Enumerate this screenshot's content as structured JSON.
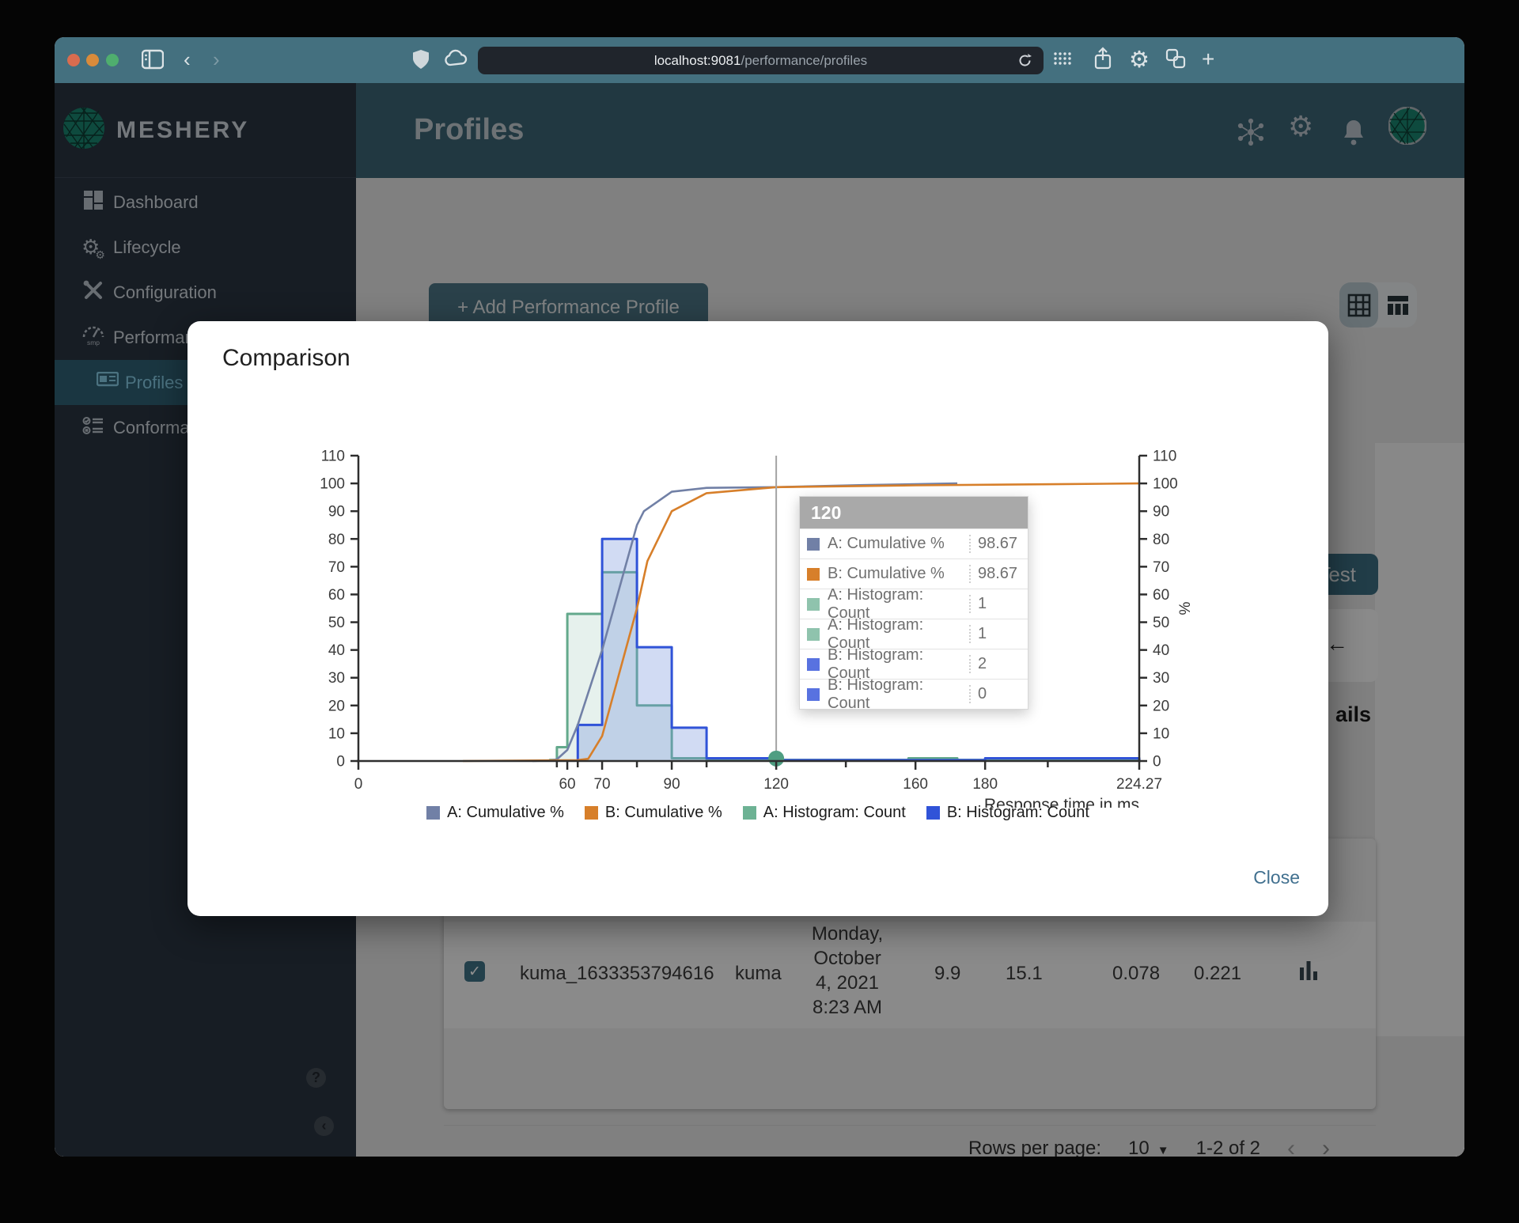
{
  "browser": {
    "url_host": "localhost:9081",
    "url_path": "/performance/profiles"
  },
  "sidebar": {
    "brand": "MESHERY",
    "items": [
      {
        "label": "Dashboard",
        "icon": "dashboard-icon",
        "selected": false
      },
      {
        "label": "Lifecycle",
        "icon": "gears-icon",
        "selected": false
      },
      {
        "label": "Configuration",
        "icon": "wrench-icon",
        "selected": false
      },
      {
        "label": "Performance",
        "icon": "speedometer-smp-icon",
        "selected": false
      },
      {
        "label": "Profiles",
        "icon": "monitor-icon",
        "selected": true
      },
      {
        "label": "Conformance",
        "icon": "checklist-icon",
        "selected": false
      }
    ],
    "help_label": "?",
    "collapse_label": "‹"
  },
  "header": {
    "title": "Profiles"
  },
  "background": {
    "add_button_label": "+ Add Performance Profile",
    "test_button_label": "Test",
    "back_arrow": "←",
    "details_fragment": "ails",
    "table_row": {
      "name": "kuma_1633353794616",
      "mesh": "kuma",
      "date_lines": [
        "Monday,",
        "October",
        "4, 2021",
        "8:23 AM"
      ],
      "qps": "9.9",
      "duration": "15.1",
      "p50": "0.078",
      "p99": "0.221"
    },
    "pagination": {
      "rows_per_page_label": "Rows per page:",
      "rows_per_page_value": "10",
      "range": "1-2 of 2",
      "prev": "‹",
      "next": "›"
    }
  },
  "modal": {
    "title": "Comparison",
    "close_label": "Close",
    "tooltip": {
      "header": "120",
      "rows": [
        {
          "label": "A: Cumulative %",
          "value": "98.67",
          "color": "#7180a6"
        },
        {
          "label": "B: Cumulative %",
          "value": "98.67",
          "color": "#d77f2a"
        },
        {
          "label": "A: Histogram: Count",
          "value": "1",
          "color": "#8fc3ad"
        },
        {
          "label": "A: Histogram: Count",
          "value": "1",
          "color": "#8fc3ad"
        },
        {
          "label": "B: Histogram: Count",
          "value": "2",
          "color": "#5872e0"
        },
        {
          "label": "B: Histogram: Count",
          "value": "0",
          "color": "#5872e0"
        }
      ]
    },
    "legend": [
      {
        "label": "A: Cumulative %",
        "color": "#7180a6"
      },
      {
        "label": "B: Cumulative %",
        "color": "#d77f2a"
      },
      {
        "label": "A: Histogram: Count",
        "color": "#6db294"
      },
      {
        "label": "B: Histogram: Count",
        "color": "#3053d8"
      }
    ]
  },
  "chart_data": {
    "type": "histogram+cumulative-line",
    "xlabel": "Response time in ms",
    "ylabel_right": "%",
    "xlim": [
      0,
      224.27
    ],
    "ylim": [
      0,
      110
    ],
    "y_ticks": [
      0,
      10,
      20,
      30,
      40,
      50,
      60,
      70,
      80,
      90,
      100,
      110
    ],
    "x_ticks_labeled": [
      {
        "v": 0,
        "t": "0"
      },
      {
        "v": 60,
        "t": "60"
      },
      {
        "v": 70,
        "t": "70"
      },
      {
        "v": 90,
        "t": "90"
      },
      {
        "v": 120,
        "t": "120"
      },
      {
        "v": 160,
        "t": "160"
      },
      {
        "v": 180,
        "t": "180"
      },
      {
        "v": 224.27,
        "t": "224.27"
      }
    ],
    "x_ticks_minor": [
      57,
      63,
      80,
      100,
      140,
      198
    ],
    "crosshair_x": 120,
    "marker": {
      "x": 120,
      "y": 0.9,
      "color": "#4f9e82"
    },
    "series": [
      {
        "name": "A: Cumulative %",
        "type": "line",
        "color": "#7180a6",
        "points": [
          [
            50,
            0
          ],
          [
            55,
            0.2
          ],
          [
            57,
            0.6
          ],
          [
            60,
            4
          ],
          [
            63,
            13
          ],
          [
            70,
            40
          ],
          [
            80,
            85
          ],
          [
            82,
            90
          ],
          [
            90,
            97
          ],
          [
            100,
            98.4
          ],
          [
            120,
            98.67
          ],
          [
            145,
            99.4
          ],
          [
            172,
            100
          ]
        ]
      },
      {
        "name": "B: Cumulative %",
        "type": "line",
        "color": "#d77f2a",
        "points": [
          [
            30,
            0
          ],
          [
            63,
            0.3
          ],
          [
            66,
            0.8
          ],
          [
            70,
            9
          ],
          [
            80,
            55
          ],
          [
            83,
            72
          ],
          [
            90,
            90
          ],
          [
            100,
            96.5
          ],
          [
            120,
            98.67
          ],
          [
            160,
            99.3
          ],
          [
            200,
            99.7
          ],
          [
            224.27,
            100
          ]
        ]
      },
      {
        "name": "A: Histogram: Count",
        "type": "histogram",
        "color": "#63a98c",
        "fill": "rgba(99,169,140,0.16)",
        "bins": [
          {
            "x0": 55,
            "x1": 57,
            "y": 0.4
          },
          {
            "x0": 57,
            "x1": 60,
            "y": 5
          },
          {
            "x0": 60,
            "x1": 70,
            "y": 53
          },
          {
            "x0": 70,
            "x1": 80,
            "y": 68
          },
          {
            "x0": 80,
            "x1": 90,
            "y": 20
          },
          {
            "x0": 90,
            "x1": 100,
            "y": 1
          },
          {
            "x0": 100,
            "x1": 158,
            "y": 0.4
          },
          {
            "x0": 158,
            "x1": 172,
            "y": 1
          },
          {
            "x0": 172,
            "x1": 224.27,
            "y": 0.4
          }
        ]
      },
      {
        "name": "B: Histogram: Count",
        "type": "histogram",
        "color": "#3053d8",
        "fill": "rgba(113,143,219,0.32)",
        "bins": [
          {
            "x0": 63,
            "x1": 70,
            "y": 13
          },
          {
            "x0": 70,
            "x1": 80,
            "y": 80
          },
          {
            "x0": 80,
            "x1": 90,
            "y": 41
          },
          {
            "x0": 90,
            "x1": 100,
            "y": 12
          },
          {
            "x0": 100,
            "x1": 120,
            "y": 1
          },
          {
            "x0": 120,
            "x1": 180,
            "y": 0.3
          },
          {
            "x0": 180,
            "x1": 224.27,
            "y": 1
          }
        ]
      }
    ]
  }
}
